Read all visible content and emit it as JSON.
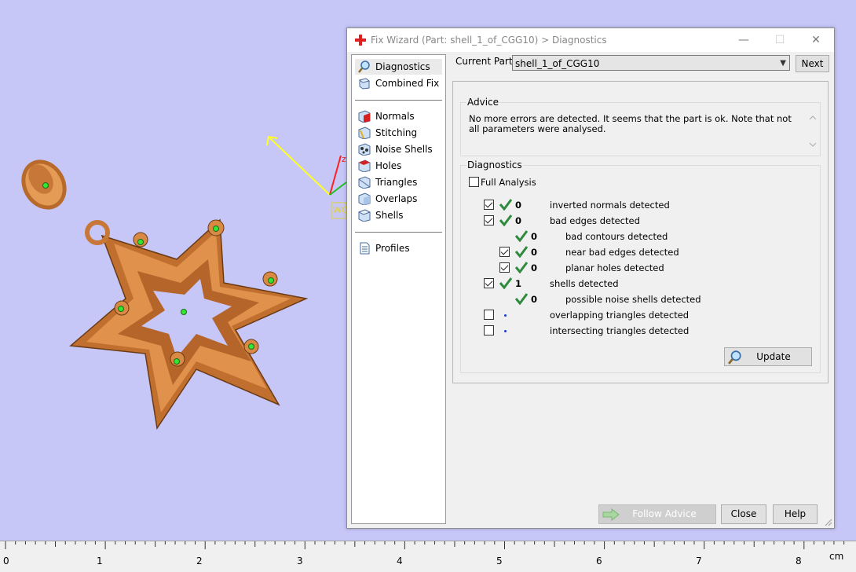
{
  "window": {
    "title": "Fix Wizard (Part: shell_1_of_CGG10) > Diagnostics",
    "minimize": "—",
    "maximize": "☐",
    "close": "✕"
  },
  "nav": {
    "items": [
      {
        "label": "Diagnostics",
        "icon": "magnifier-icon"
      },
      {
        "label": "Combined Fix",
        "icon": "combined-fix-icon"
      },
      {
        "label": "Normals",
        "icon": "normals-cube-icon"
      },
      {
        "label": "Stitching",
        "icon": "stitching-cube-icon"
      },
      {
        "label": "Noise Shells",
        "icon": "noise-shells-icon"
      },
      {
        "label": "Holes",
        "icon": "holes-cube-icon"
      },
      {
        "label": "Triangles",
        "icon": "triangles-cube-icon"
      },
      {
        "label": "Overlaps",
        "icon": "overlaps-cube-icon"
      },
      {
        "label": "Shells",
        "icon": "shells-cube-icon"
      },
      {
        "label": "Profiles",
        "icon": "document-icon"
      }
    ]
  },
  "current_part": {
    "label": "Current Part:",
    "value": "shell_1_of_CGG10",
    "next_label": "Next"
  },
  "advice": {
    "title": "Advice",
    "text": "No more errors are detected. It seems that the part is ok. Note that not all parameters were analysed."
  },
  "diagnostics": {
    "title": "Diagnostics",
    "full_analysis_label": "Full Analysis",
    "full_analysis_checked": false,
    "rows": [
      {
        "checkbox": true,
        "checked": true,
        "status": "ok",
        "count": "0",
        "label": "inverted normals detected",
        "indent": 0
      },
      {
        "checkbox": true,
        "checked": true,
        "status": "ok",
        "count": "0",
        "label": "bad edges detected",
        "indent": 0
      },
      {
        "checkbox": false,
        "checked": false,
        "status": "ok",
        "count": "0",
        "label": "bad contours detected",
        "indent": 1
      },
      {
        "checkbox": true,
        "checked": true,
        "status": "ok",
        "count": "0",
        "label": "near bad edges detected",
        "indent": 1
      },
      {
        "checkbox": true,
        "checked": true,
        "status": "ok",
        "count": "0",
        "label": "planar holes detected",
        "indent": 1
      },
      {
        "checkbox": true,
        "checked": true,
        "status": "ok",
        "count": "1",
        "label": "shells detected",
        "indent": 0
      },
      {
        "checkbox": false,
        "checked": false,
        "status": "ok",
        "count": "0",
        "label": "possible noise shells detected",
        "indent": 1
      },
      {
        "checkbox": true,
        "checked": false,
        "status": "dot",
        "count": "",
        "label": "overlapping triangles detected",
        "indent": 0
      },
      {
        "checkbox": true,
        "checked": false,
        "status": "dot",
        "count": "",
        "label": "intersecting triangles detected",
        "indent": 0
      }
    ],
    "update_label": "Update"
  },
  "footer": {
    "follow_advice_label": "Follow Advice",
    "close_label": "Close",
    "help_label": "Help"
  },
  "viewport": {
    "axis_label": "WO",
    "z_label": "z"
  },
  "ruler": {
    "labels": [
      "0",
      "1",
      "2",
      "3",
      "4",
      "5",
      "6",
      "7",
      "8"
    ],
    "unit": "cm"
  },
  "colors": {
    "viewport_bg": "#c6c6f7",
    "part_orange": "#d98a45",
    "check_green": "#2e8b3d"
  }
}
